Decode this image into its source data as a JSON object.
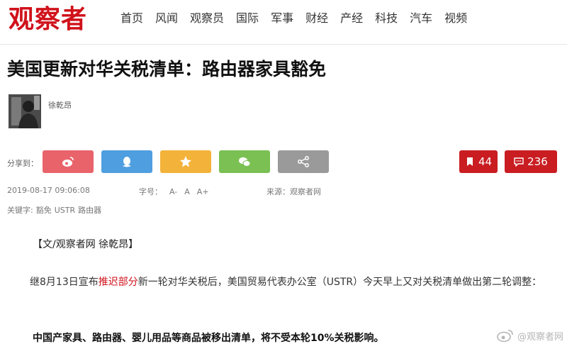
{
  "site": {
    "logo": "观察者"
  },
  "nav": {
    "items": [
      "首页",
      "风闻",
      "观察员",
      "国际",
      "军事",
      "财经",
      "产经",
      "科技",
      "汽车",
      "视频"
    ]
  },
  "article": {
    "title": "美国更新对华关税清单：路由器家具豁免",
    "author": "徐乾昂",
    "share_label": "分享到：",
    "favorites_count": "44",
    "comments_count": "236",
    "date": "2019-08-17 09:06:08",
    "font_label": "字号：",
    "font_sizes": [
      "A-",
      "A",
      "A+"
    ],
    "source": "来源：观察者网",
    "keywords_label": "关键字:",
    "keywords": [
      "豁免",
      "USTR",
      "路由器"
    ],
    "byline": "【文/观察者网 徐乾昂】",
    "para1_before": "继8月13日宣布",
    "para1_link": "推迟部分",
    "para1_after": "新一轮对华关税后，美国贸易代表办公室（USTR）今天早上又对关税清单做出第二轮调整：",
    "para2": "中国产家具、路由器、婴儿用品等商品被移出清单，将不受本轮10%关税影响。"
  },
  "watermark": {
    "text": "@观察者网"
  },
  "colors": {
    "brand_red": "#d0121b",
    "count_red": "#c91d22"
  },
  "icons": [
    "weibo-icon",
    "qq-icon",
    "qzone-star-icon",
    "wechat-icon",
    "share-icon",
    "bookmark-icon",
    "comment-icon"
  ]
}
